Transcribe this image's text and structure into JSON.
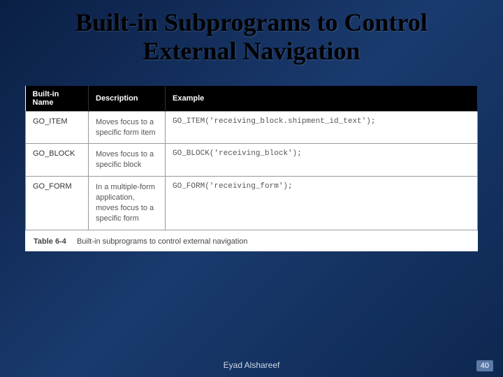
{
  "title_line1": "Built-in Subprograms to Control",
  "title_line2": "External Navigation",
  "table": {
    "headers": {
      "name": "Built-in Name",
      "desc": "Description",
      "ex": "Example"
    },
    "rows": [
      {
        "name": "GO_ITEM",
        "desc": "Moves focus to a specific form item",
        "ex": "GO_ITEM('receiving_block.shipment_id_text');"
      },
      {
        "name": "GO_BLOCK",
        "desc": "Moves focus to a specific block",
        "ex": "GO_BLOCK('receiving_block');"
      },
      {
        "name": "GO_FORM",
        "desc": "In a multiple-form application, moves focus to a specific form",
        "ex": "GO_FORM('receiving_form');"
      }
    ]
  },
  "caption_label": "Table 6-4",
  "caption_text": "Built-in subprograms to control external navigation",
  "author": "Eyad Alshareef",
  "page": "40"
}
